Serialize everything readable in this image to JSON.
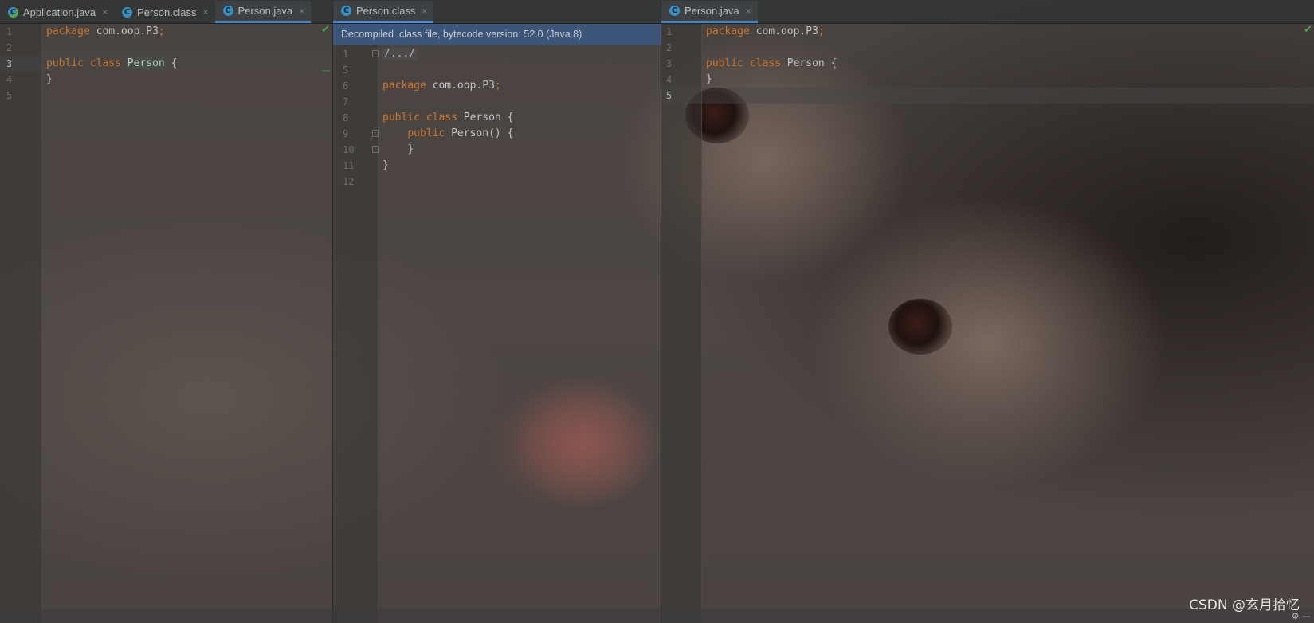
{
  "left_pane": {
    "tabs": [
      {
        "label": "Application.java",
        "icon": "class-icon",
        "active": false
      },
      {
        "label": "Person.class",
        "icon": "class-icon",
        "active": false
      },
      {
        "label": "Person.java",
        "icon": "class-icon",
        "active": true
      }
    ],
    "lines": [
      {
        "n": "1",
        "code": "package com.oop.P3;"
      },
      {
        "n": "2",
        "code": ""
      },
      {
        "n": "3",
        "code": "public class Person {"
      },
      {
        "n": "4",
        "code": "}"
      },
      {
        "n": "5",
        "code": ""
      }
    ],
    "current_line": "3"
  },
  "middle_pane": {
    "tabs": [
      {
        "label": "Person.class",
        "icon": "class-icon",
        "active": true
      }
    ],
    "banner": "Decompiled .class file, bytecode version: 52.0 (Java 8)",
    "lines": [
      {
        "n": "1",
        "code": "/.../"
      },
      {
        "n": "5",
        "code": ""
      },
      {
        "n": "6",
        "code": "package com.oop.P3;"
      },
      {
        "n": "7",
        "code": ""
      },
      {
        "n": "8",
        "code": "public class Person {"
      },
      {
        "n": "9",
        "code": "    public Person() {"
      },
      {
        "n": "10",
        "code": "    }"
      },
      {
        "n": "11",
        "code": "}"
      },
      {
        "n": "12",
        "code": ""
      }
    ]
  },
  "right_pane": {
    "tabs": [
      {
        "label": "Person.java",
        "icon": "class-icon",
        "active": true
      }
    ],
    "lines": [
      {
        "n": "1",
        "code": "package com.oop.P3;"
      },
      {
        "n": "2",
        "code": ""
      },
      {
        "n": "3",
        "code": "public class Person {"
      },
      {
        "n": "4",
        "code": "}"
      },
      {
        "n": "5",
        "code": ""
      }
    ],
    "current_line": "5"
  },
  "tokens": {
    "package": "package",
    "pkg_name": "com.oop.P3",
    "semicolon": ";",
    "public": "public",
    "class": "class",
    "Person": "Person",
    "open_brace": "{",
    "close_brace": "}",
    "ctor_parens": "()",
    "folded": "/.../"
  },
  "close_glyph": "×",
  "watermark": "CSDN @玄月拾忆",
  "colors": {
    "keyword": "#cc7832",
    "text": "#bfc3c7",
    "banner_bg": "#3a5882",
    "active_tab_underline": "#4a88c7",
    "check": "#4fa34b"
  }
}
